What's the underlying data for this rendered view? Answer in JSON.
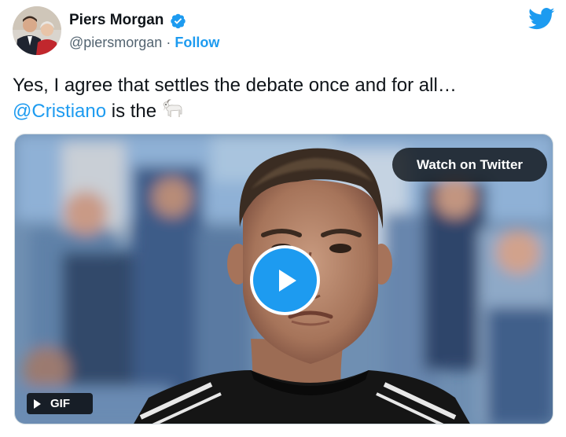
{
  "author": {
    "name": "Piers Morgan",
    "handle": "@piersmorgan",
    "separator": " · ",
    "follow_label": "Follow"
  },
  "tweet": {
    "line1": "Yes, I agree that settles the debate once and for all…",
    "mention": "@Cristiano",
    "line2_rest": " is the",
    "emoji": "goat-emoji"
  },
  "media": {
    "watch_label": "Watch on Twitter",
    "badge_label": "GIF",
    "play_icon": "play-icon"
  },
  "colors": {
    "accent": "#1d9bf0",
    "text": "#0f1419",
    "muted": "#536471"
  },
  "icons": [
    "twitter-bird-icon",
    "verified-badge-icon",
    "play-icon",
    "goat-emoji"
  ]
}
